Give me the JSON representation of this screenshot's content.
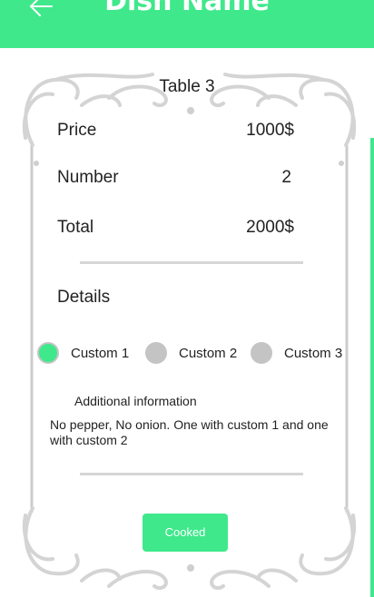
{
  "header": {
    "title": "Dish Name",
    "back_icon": "back-arrow-icon",
    "color": "#3fe88b"
  },
  "table": {
    "title": "Table 3"
  },
  "summary": {
    "price": {
      "label": "Price",
      "value": "1000$"
    },
    "number": {
      "label": "Number",
      "value": "2"
    },
    "total": {
      "label": "Total",
      "value": "2000$"
    }
  },
  "details": {
    "heading": "Details",
    "options": [
      {
        "label": "Custom 1",
        "selected": true
      },
      {
        "label": "Custom 2",
        "selected": false
      },
      {
        "label": "Custom 3",
        "selected": false
      }
    ],
    "additional_label": "Additional information",
    "additional_text": "No pepper, No onion. One with custom 1 and one with custom 2"
  },
  "actions": {
    "cooked_label": "Cooked"
  }
}
